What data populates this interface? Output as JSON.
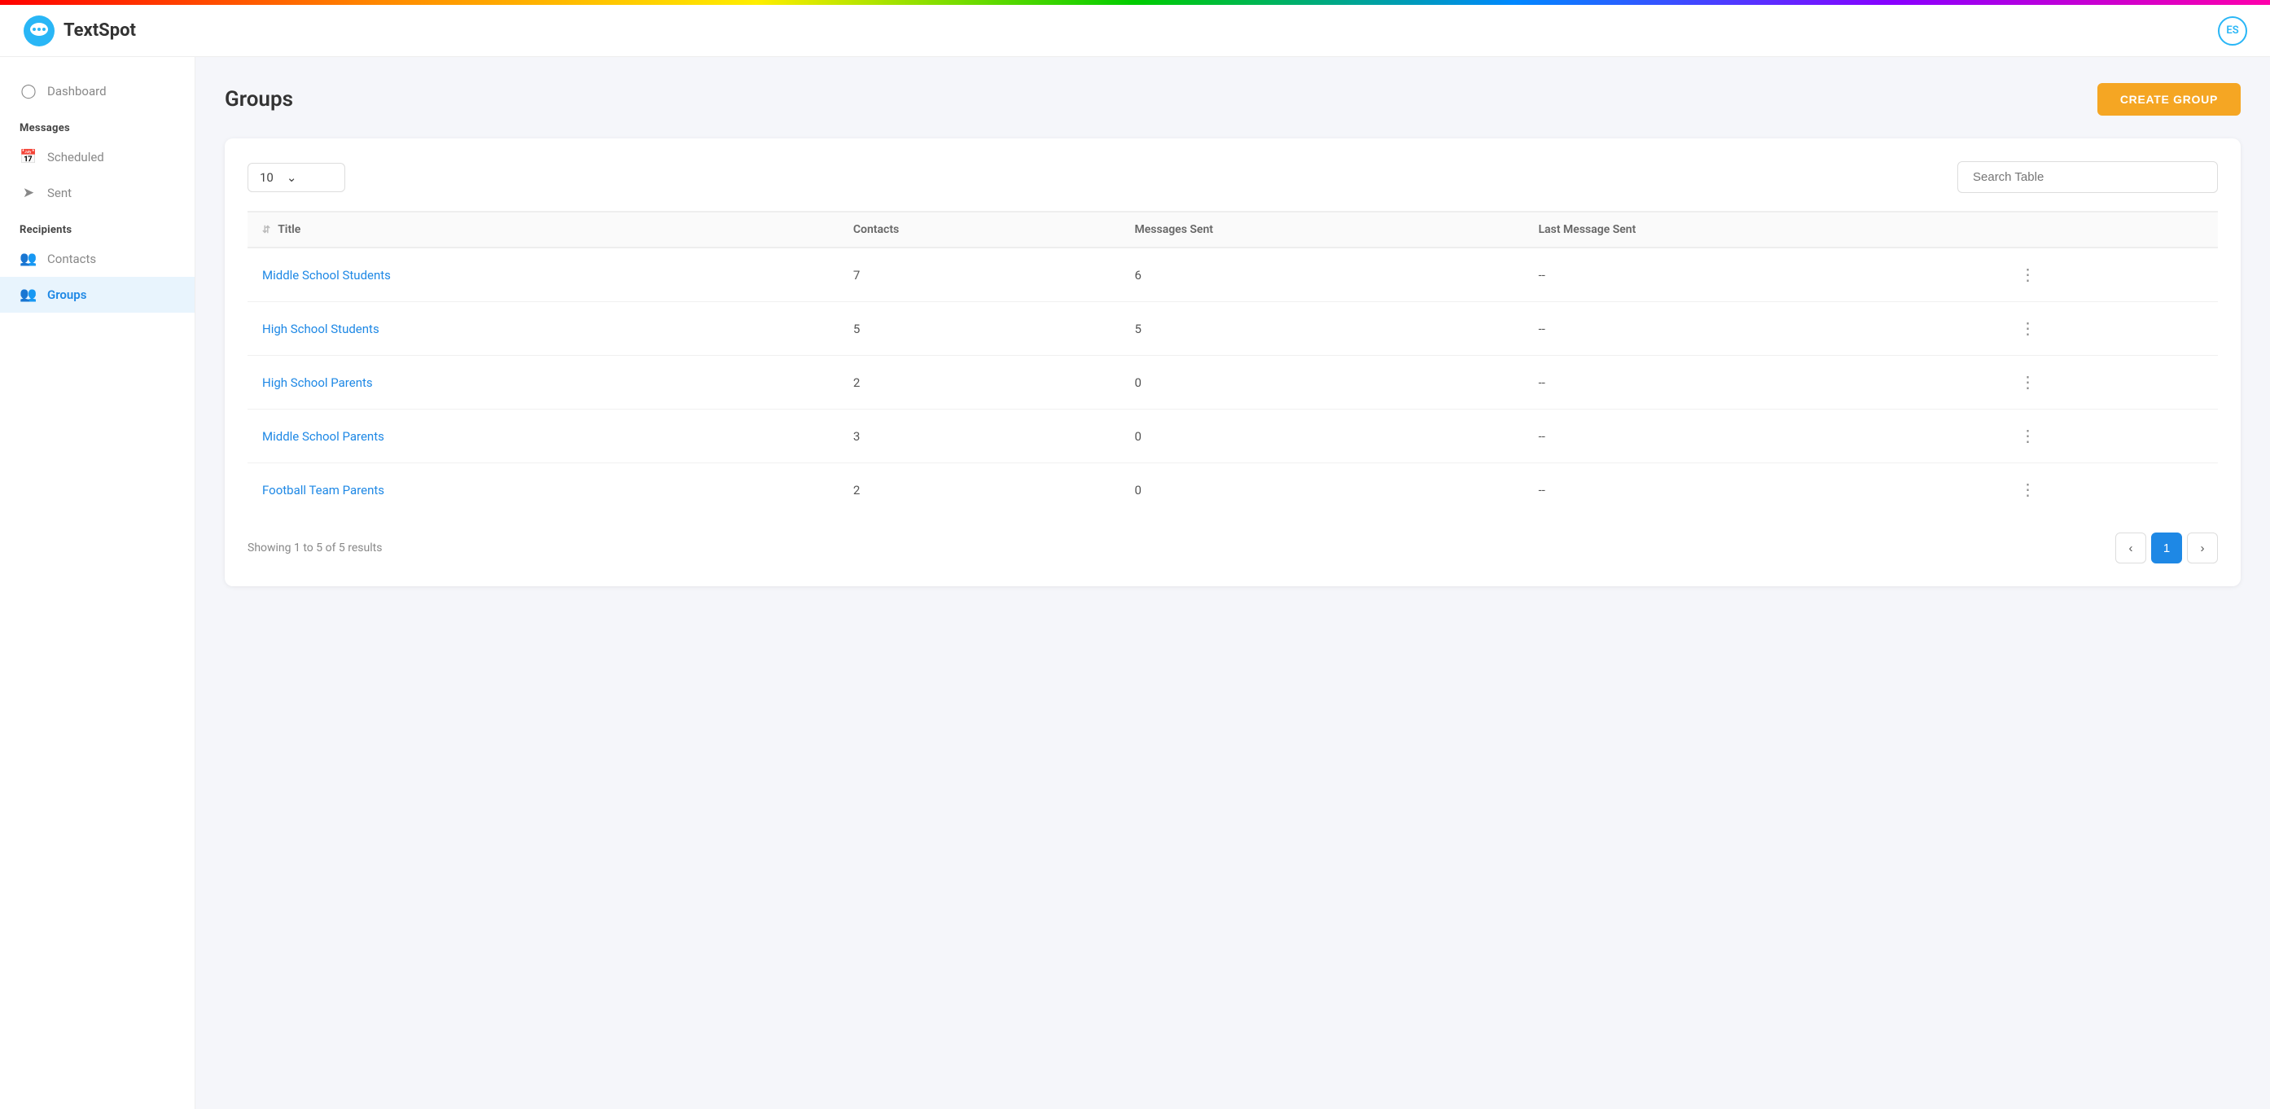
{
  "rainbow_bar": {},
  "header": {
    "logo_text": "TextSpot",
    "user_initials": "ES"
  },
  "sidebar": {
    "dashboard_label": "Dashboard",
    "messages_section": "Messages",
    "scheduled_label": "Scheduled",
    "sent_label": "Sent",
    "recipients_section": "Recipients",
    "contacts_label": "Contacts",
    "groups_label": "Groups"
  },
  "page": {
    "title": "Groups",
    "create_button": "CREATE GROUP"
  },
  "table_controls": {
    "rows_value": "10",
    "search_placeholder": "Search Table"
  },
  "table": {
    "columns": [
      {
        "key": "title",
        "label": "Title",
        "sortable": true
      },
      {
        "key": "contacts",
        "label": "Contacts",
        "sortable": false
      },
      {
        "key": "messages_sent",
        "label": "Messages Sent",
        "sortable": false
      },
      {
        "key": "last_message_sent",
        "label": "Last Message Sent",
        "sortable": false
      }
    ],
    "rows": [
      {
        "title": "Middle School Students",
        "contacts": "7",
        "messages_sent": "6",
        "last_message_sent": "--"
      },
      {
        "title": "High School Students",
        "contacts": "5",
        "messages_sent": "5",
        "last_message_sent": "--"
      },
      {
        "title": "High School Parents",
        "contacts": "2",
        "messages_sent": "0",
        "last_message_sent": "--"
      },
      {
        "title": "Middle School Parents",
        "contacts": "3",
        "messages_sent": "0",
        "last_message_sent": "--"
      },
      {
        "title": "Football Team Parents",
        "contacts": "2",
        "messages_sent": "0",
        "last_message_sent": "--"
      }
    ]
  },
  "footer": {
    "results_info": "Showing 1 to 5 of 5 results",
    "current_page": "1"
  }
}
